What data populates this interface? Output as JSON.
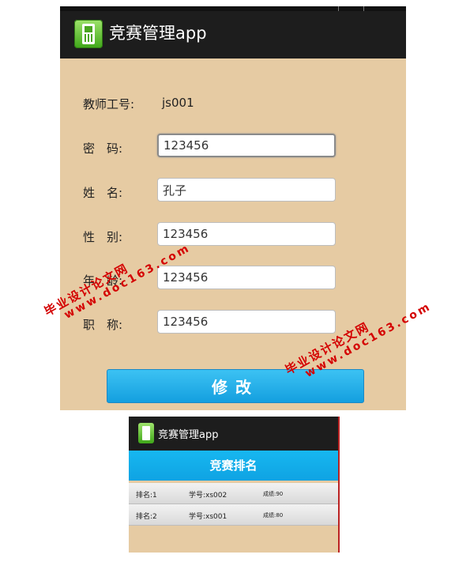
{
  "screen1": {
    "app_title": "竞赛管理app",
    "teacher_id_label": "教师工号:",
    "teacher_id_value": "js001",
    "form": [
      {
        "label": "密　码:",
        "value": "123456"
      },
      {
        "label": "姓　名:",
        "value": "孔子"
      },
      {
        "label": "性　别:",
        "value": "123456"
      },
      {
        "label": "年　龄:",
        "value": "123456"
      },
      {
        "label": "职　称:",
        "value": "123456"
      }
    ],
    "submit_label": "修改"
  },
  "screen2": {
    "app_title": "竞赛管理app",
    "header": "竞赛排名",
    "rows": [
      {
        "rank": "排名:1",
        "student_id": "学号:xs002",
        "score": "成绩:90"
      },
      {
        "rank": "排名:2",
        "student_id": "学号:xs001",
        "score": "成绩:80"
      }
    ]
  },
  "watermark": {
    "line1": "毕业设计论文网",
    "line2": "www.doc163.com"
  },
  "colors": {
    "background": "#e6cba3",
    "action_bar": "#1d1d1d",
    "accent": "#149fdf",
    "watermark": "#d40000"
  }
}
